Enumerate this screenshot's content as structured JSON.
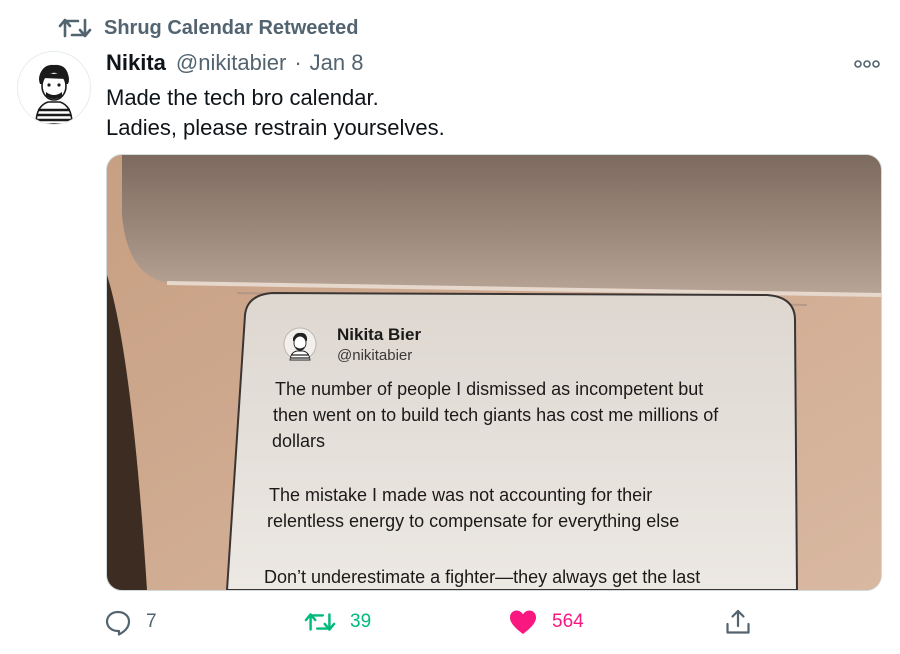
{
  "retweet_context": {
    "label": "Shrug Calendar Retweeted"
  },
  "author": {
    "name": "Nikita",
    "handle": "@nikitabier",
    "separator": "·",
    "date": "Jan 8"
  },
  "tweet": {
    "lines": [
      "Made the tech bro calendar.",
      "Ladies, please restrain yourselves."
    ]
  },
  "photo": {
    "embedded_tweet": {
      "name": "Nikita Bier",
      "handle": "@nikitabier",
      "paragraph1": [
        "The number of people I dismissed as incompetent but",
        "then went on to build tech giants has cost me millions of",
        "dollars"
      ],
      "paragraph2": [
        "The mistake I made was not accounting for their",
        "relentless energy to compensate for everything else"
      ],
      "paragraph3": [
        "Don’t underestimate a fighter—they always get the last"
      ]
    }
  },
  "actions": {
    "reply_count": "7",
    "retweet_count": "39",
    "like_count": "564"
  },
  "colors": {
    "text_primary": "#0f1419",
    "text_secondary": "#536471",
    "retweet_active": "#00ba7c",
    "like_active": "#f91880"
  },
  "icons": [
    "retweet-icon",
    "more-icon",
    "reply-icon",
    "like-icon",
    "share-icon"
  ]
}
